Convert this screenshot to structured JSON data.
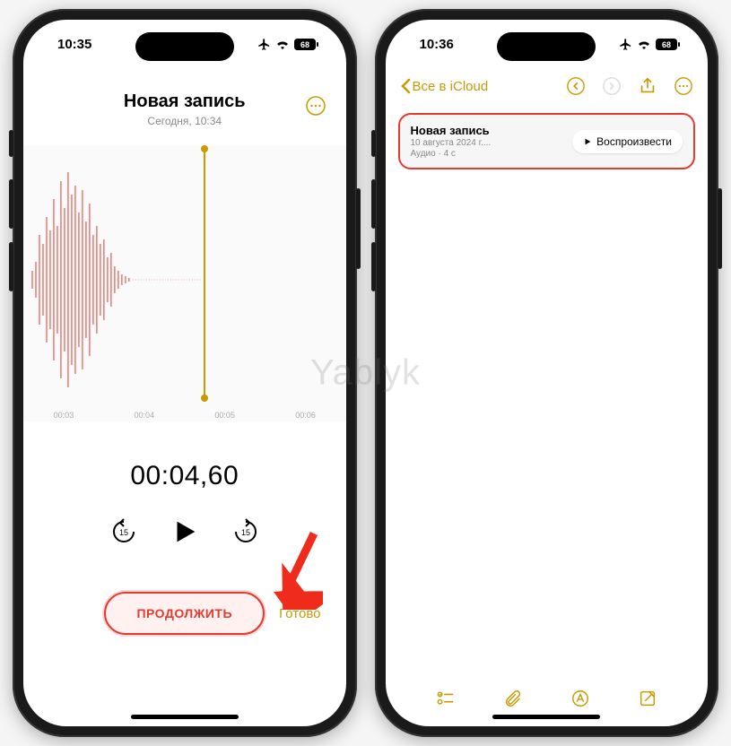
{
  "watermark": "Yablyk",
  "left": {
    "status": {
      "time": "10:35",
      "battery": "68"
    },
    "title": "Новая запись",
    "subtitle": "Сегодня, 10:34",
    "ruler": [
      "00:03",
      "00:04",
      "00:05",
      "00:06"
    ],
    "timer": "00:04,60",
    "skip_amount": "15",
    "continue_label": "ПРОДОЛЖИТЬ",
    "done_label": "Готово"
  },
  "right": {
    "status": {
      "time": "10:36",
      "battery": "68"
    },
    "back_label": "Все в iCloud",
    "card": {
      "title": "Новая запись",
      "subtitle": "10 августа 2024 г....",
      "meta": "Аудио · 4 с",
      "play_label": "Воспроизвести"
    }
  }
}
